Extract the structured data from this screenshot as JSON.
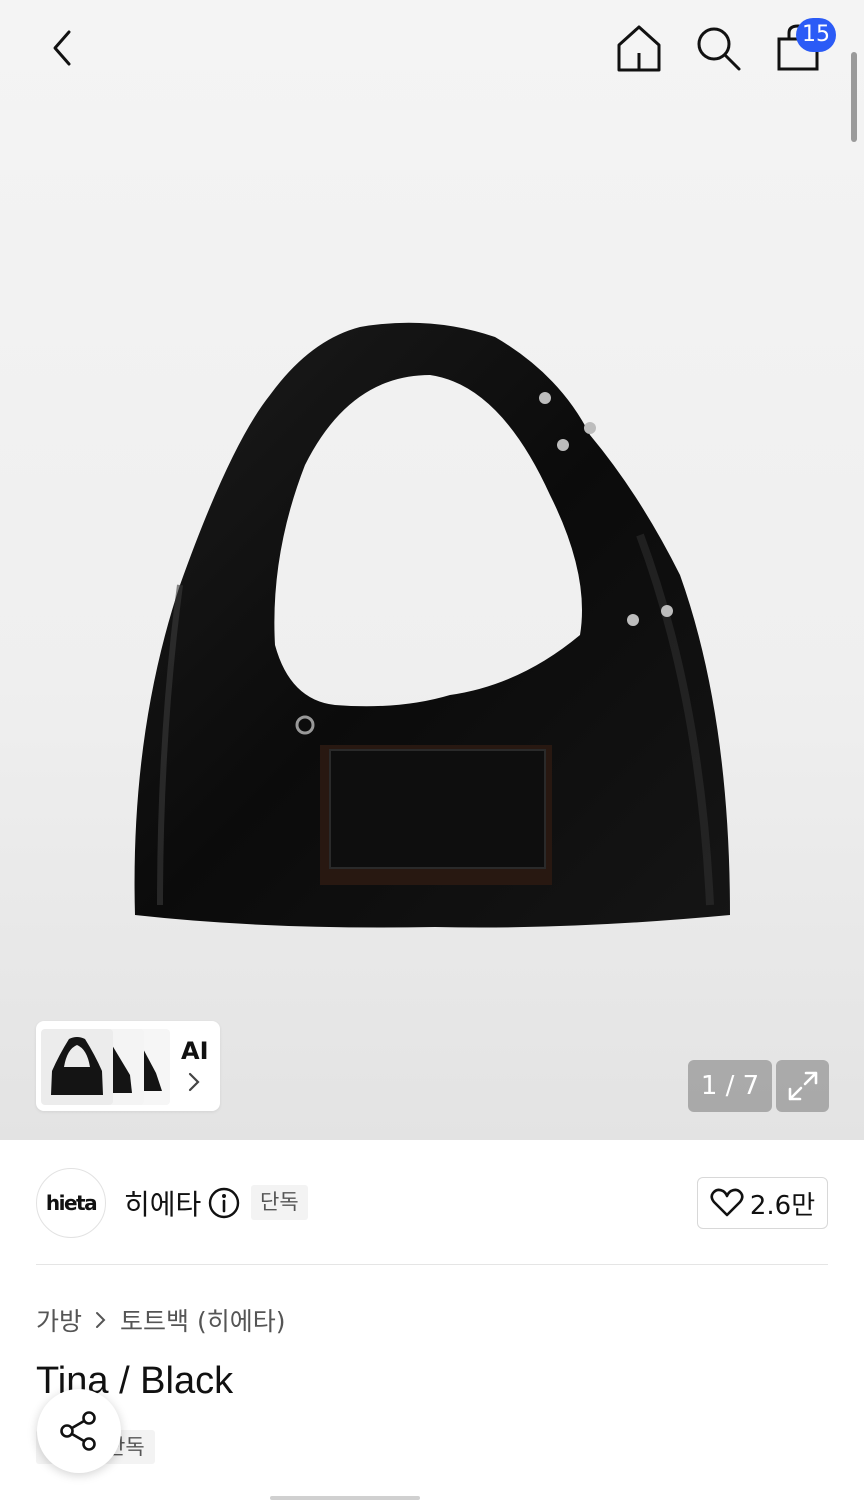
{
  "header": {
    "back_icon": "chevron-left-icon",
    "home_icon": "home-icon",
    "search_icon": "search-icon",
    "cart_icon": "shopping-bag-icon",
    "cart_count": "15",
    "badge_color": "#2b5bf6"
  },
  "gallery": {
    "ai_label": "AI",
    "page_indicator": "1 / 7",
    "expand_icon": "expand-icon"
  },
  "brand": {
    "logo_text": "hieta",
    "name": "히에타",
    "exclusive_tag": "단독",
    "like_count": "2.6만"
  },
  "breadcrumb": {
    "items": [
      "가방",
      "토트백 (히에타)"
    ]
  },
  "product": {
    "title": "Tina / Black",
    "tag": "단독"
  },
  "actions": {
    "share_icon": "share-icon"
  }
}
